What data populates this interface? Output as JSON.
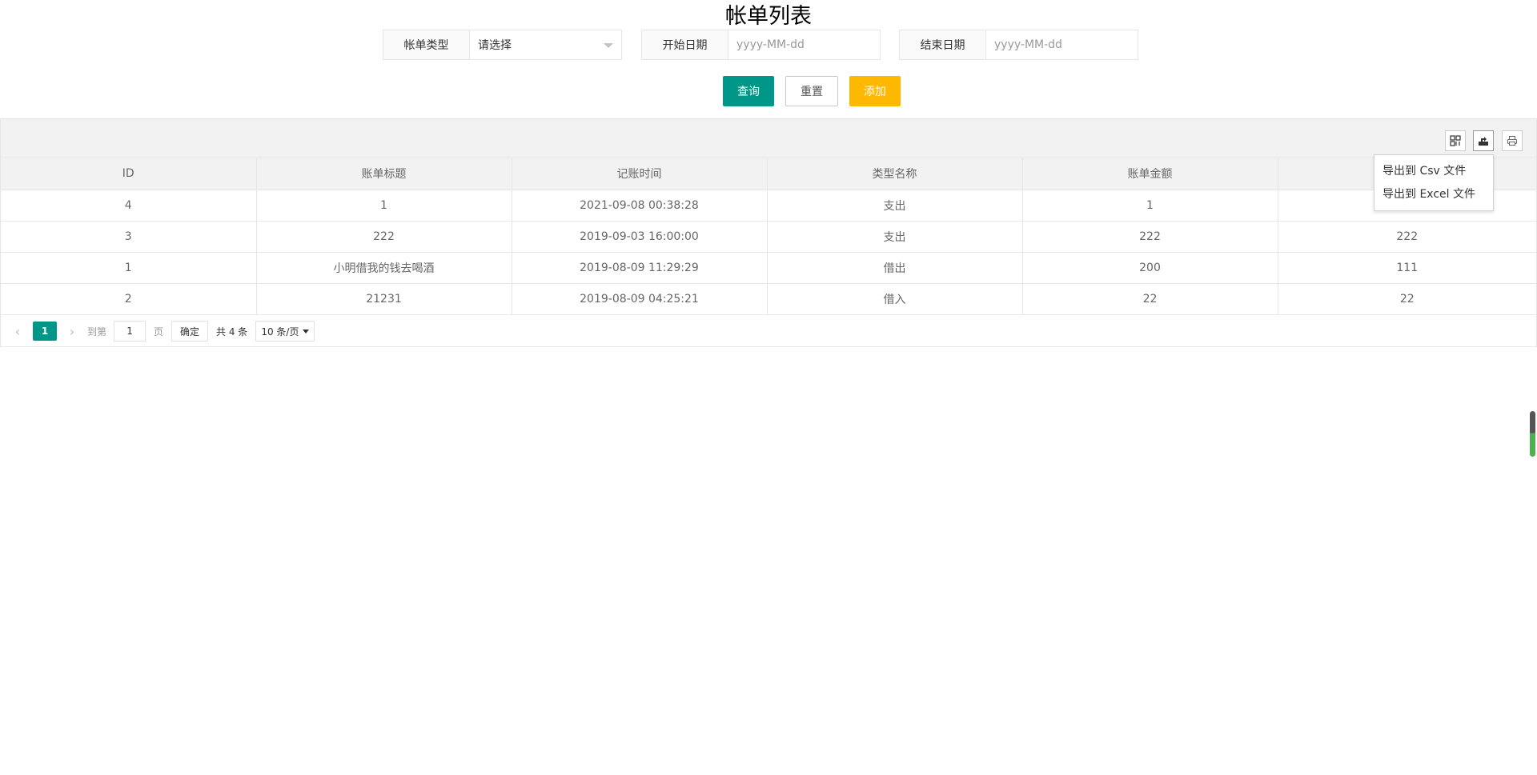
{
  "page_title": "帐单列表",
  "filters": {
    "type": {
      "label": "帐单类型",
      "value": "请选择"
    },
    "start_date": {
      "label": "开始日期",
      "placeholder": "yyyy-MM-dd"
    },
    "end_date": {
      "label": "结束日期",
      "placeholder": "yyyy-MM-dd"
    }
  },
  "actions": {
    "query": "查询",
    "reset": "重置",
    "add": "添加"
  },
  "toolbar": {
    "icons": [
      "columns-icon",
      "export-icon",
      "print-icon"
    ]
  },
  "export_menu": {
    "items": [
      "导出到 Csv 文件",
      "导出到 Excel 文件"
    ]
  },
  "table": {
    "columns": [
      "ID",
      "账单标题",
      "记账时间",
      "类型名称",
      "账单金额",
      ""
    ],
    "rows": [
      [
        "4",
        "1",
        "2021-09-08 00:38:28",
        "支出",
        "1",
        ""
      ],
      [
        "3",
        "222",
        "2019-09-03 16:00:00",
        "支出",
        "222",
        "222"
      ],
      [
        "1",
        "小明借我的钱去喝酒",
        "2019-08-09 11:29:29",
        "借出",
        "200",
        "111"
      ],
      [
        "2",
        "21231",
        "2019-08-09 04:25:21",
        "借入",
        "22",
        "22"
      ]
    ]
  },
  "pagination": {
    "current_page": "1",
    "skip_label": "到第",
    "skip_value": "1",
    "page_label": "页",
    "go_label": "确定",
    "count_text": "共 4 条",
    "limit_text": "10 条/页"
  },
  "colors": {
    "primary": "#009688",
    "warm": "#ffb800"
  }
}
